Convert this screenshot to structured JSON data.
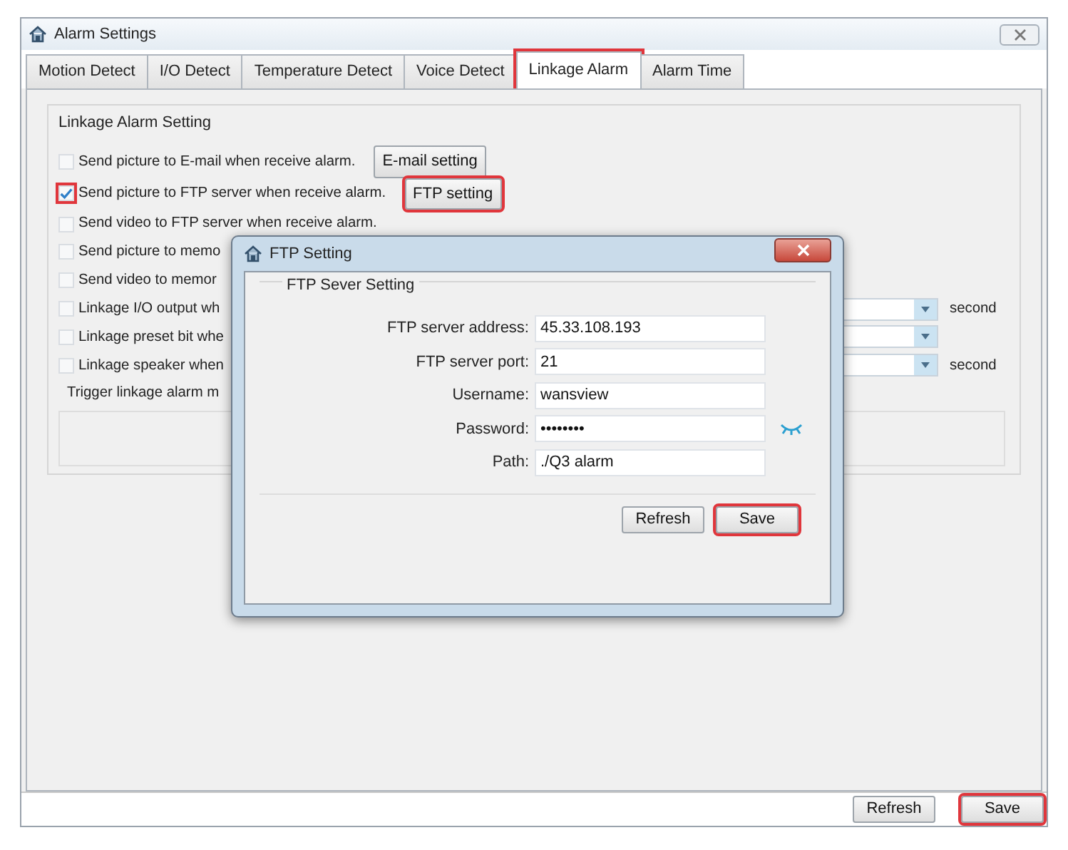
{
  "window": {
    "title": "Alarm Settings"
  },
  "tabs": [
    {
      "label": "Motion Detect",
      "selected": false,
      "highlighted": false
    },
    {
      "label": "I/O Detect",
      "selected": false,
      "highlighted": false
    },
    {
      "label": "Temperature Detect",
      "selected": false,
      "highlighted": false
    },
    {
      "label": "Voice Detect",
      "selected": false,
      "highlighted": false
    },
    {
      "label": "Linkage Alarm",
      "selected": true,
      "highlighted": true
    },
    {
      "label": "Alarm Time",
      "selected": false,
      "highlighted": false
    }
  ],
  "group": {
    "title": "Linkage Alarm Setting",
    "options": [
      {
        "kind": "button",
        "label": "Send picture to E-mail when receive alarm.",
        "checked": false,
        "highlighted": false,
        "button": {
          "label": "E-mail setting",
          "highlighted": false
        }
      },
      {
        "kind": "button",
        "label": "Send picture to FTP server when receive alarm.",
        "checked": true,
        "highlighted": true,
        "button": {
          "label": "FTP setting",
          "highlighted": true
        }
      },
      {
        "kind": "plain",
        "label": "Send video to FTP server when receive alarm.",
        "checked": false,
        "highlighted": false
      },
      {
        "kind": "plain",
        "label": "Send picture to memo",
        "checked": false,
        "highlighted": false
      },
      {
        "kind": "plain",
        "label": "Send video to memor",
        "checked": false,
        "highlighted": false
      },
      {
        "kind": "dropdown",
        "label": "Linkage I/O output wh",
        "checked": false,
        "highlighted": false,
        "unit": "second"
      },
      {
        "kind": "dropdown",
        "label": "Linkage preset bit whe",
        "checked": false,
        "highlighted": false
      },
      {
        "kind": "dropdown",
        "label": "Linkage speaker when",
        "checked": false,
        "highlighted": false,
        "unit": "second"
      }
    ],
    "trigger_label": "Trigger linkage alarm m"
  },
  "dialog": {
    "title": "FTP Setting",
    "group_title": "FTP Sever Setting",
    "fields": [
      {
        "kind": "text",
        "label": "FTP server address:",
        "value": "45.33.108.193"
      },
      {
        "kind": "text",
        "label": "FTP server port:",
        "value": "21"
      },
      {
        "kind": "text",
        "label": "Username:",
        "value": "wansview"
      },
      {
        "kind": "password",
        "label": "Password:",
        "value": "••••••••"
      },
      {
        "kind": "text",
        "label": "Path:",
        "value": "./Q3 alarm"
      }
    ],
    "buttons": [
      {
        "label": "Refresh",
        "highlighted": false
      },
      {
        "label": "Save",
        "highlighted": true
      }
    ]
  },
  "footer_buttons": [
    {
      "label": "Refresh",
      "highlighted": false
    },
    {
      "label": "Save",
      "highlighted": true
    }
  ]
}
